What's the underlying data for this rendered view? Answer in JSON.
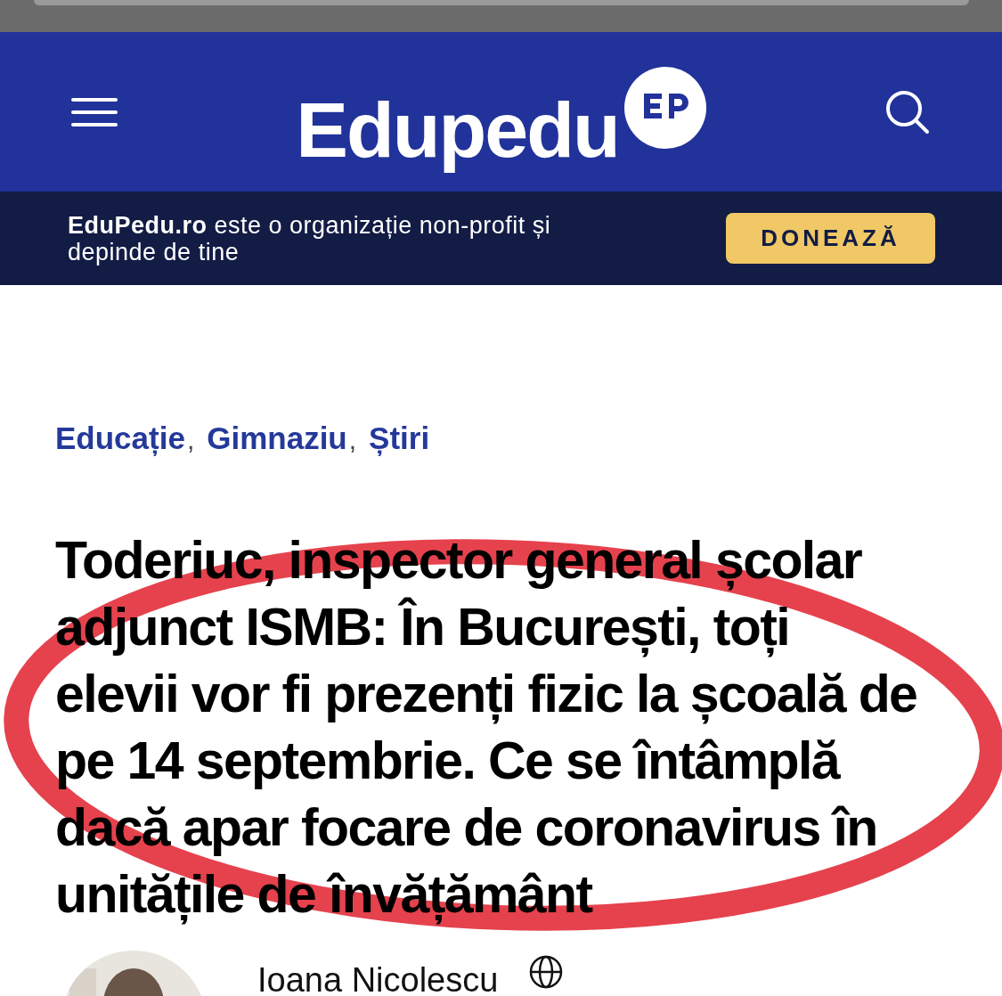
{
  "header": {
    "logo": "Edupedu"
  },
  "banner": {
    "text": "**EduPedu.ro** este o organizație non-profit și depinde de tine",
    "button": "DONEAZĂ"
  },
  "categories": [
    {
      "label": "Educație",
      "separator": ","
    },
    {
      "label": "Gimnaziu",
      "separator": ","
    },
    {
      "label": "Știri"
    }
  ],
  "headline_lines": [
    "Toderiuc, inspector general școlar",
    "adjunct ISMB: În București, toți",
    "elevii vor fi prezenți fizic la școală de",
    "pe 14 septembrie. Ce se întâmplă",
    "dacă apar focare de coronavirus în",
    "unitățile de învățământ"
  ],
  "author": {
    "name": "Ioana Nicolescu"
  }
}
